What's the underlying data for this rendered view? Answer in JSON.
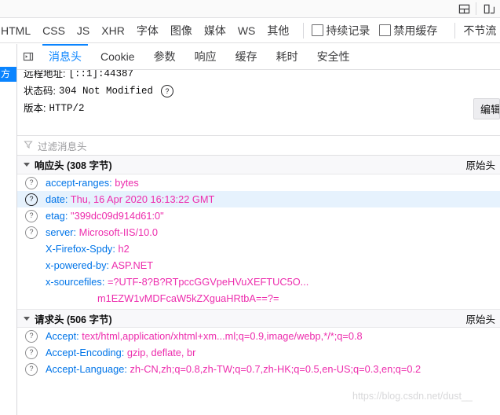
{
  "window": {
    "icons": [
      "split-panel-icon",
      "responsive-device-icon"
    ]
  },
  "filter_bar": {
    "types": [
      "HTML",
      "CSS",
      "JS",
      "XHR",
      "字体",
      "图像",
      "媒体",
      "WS",
      "其他"
    ],
    "checkboxes": [
      {
        "label": "持续记录",
        "checked": false
      },
      {
        "label": "禁用缓存",
        "checked": false
      }
    ],
    "throttle_label": "不节流"
  },
  "request_list": {
    "selected_row_text": "方"
  },
  "detail": {
    "panel_toggle_icon": "toggle-panel-icon",
    "tabs": [
      {
        "label": "消息头",
        "active": true
      },
      {
        "label": "Cookie",
        "active": false
      },
      {
        "label": "参数",
        "active": false
      },
      {
        "label": "响应",
        "active": false
      },
      {
        "label": "缓存",
        "active": false
      },
      {
        "label": "耗时",
        "active": false
      },
      {
        "label": "安全性",
        "active": false
      }
    ],
    "summary": {
      "remote_address_label": "远程地址:",
      "remote_address_value": "[::1]:44387",
      "status_label": "状态码:",
      "status_value": "304  Not Modified",
      "status_help_icon": "question-circle-icon",
      "version_label": "版本:",
      "version_value": "HTTP/2",
      "edit_resend_label": "编辑和重发"
    },
    "header_filter": {
      "icon": "filter-icon",
      "placeholder": "过滤消息头"
    },
    "response_section": {
      "title": "响应头 (308 字节)",
      "raw_label": "原始头",
      "expanded": true,
      "rows": [
        {
          "key": "accept-ranges:",
          "value": "bytes",
          "selected": false,
          "has_help": true
        },
        {
          "key": "date:",
          "value": "Thu, 16 Apr 2020 16:13:22 GMT",
          "selected": true,
          "has_help": true
        },
        {
          "key": "etag:",
          "value": "\"399dc09d914d61:0\"",
          "selected": false,
          "has_help": true
        },
        {
          "key": "server:",
          "value": "Microsoft-IIS/10.0",
          "selected": false,
          "has_help": true
        },
        {
          "key": "X-Firefox-Spdy:",
          "value": "h2",
          "selected": false,
          "has_help": false
        },
        {
          "key": "x-powered-by:",
          "value": "ASP.NET",
          "selected": false,
          "has_help": false
        },
        {
          "key": "x-sourcefiles:",
          "value": "=?UTF-8?B?RTpccGGVpeHVuXEFTUC5O...",
          "continuation": "m1EZW1vMDFcaW5kZXguaHRtbA==?=",
          "selected": false,
          "has_help": false
        }
      ]
    },
    "request_section": {
      "title": "请求头 (506 字节)",
      "raw_label": "原始头",
      "expanded": true,
      "rows": [
        {
          "key": "Accept:",
          "value": "text/html,application/xhtml+xm...ml;q=0.9,image/webp,*/*;q=0.8",
          "selected": false,
          "has_help": true
        },
        {
          "key": "Accept-Encoding:",
          "value": "gzip, deflate, br",
          "selected": false,
          "has_help": true
        },
        {
          "key": "Accept-Language:",
          "value": "zh-CN,zh;q=0.8,zh-TW;q=0.7,zh-HK;q=0.5,en-US;q=0.3,en;q=0.2",
          "selected": false,
          "has_help": true
        }
      ]
    }
  },
  "watermark": "https://blog.csdn.net/dust__",
  "colors": {
    "accent": "#0a84ff",
    "header_key": "#0074e8",
    "header_value": "#ed2dad",
    "selection_row": "#e6f2fd",
    "selected_request": "#0a84ff"
  }
}
